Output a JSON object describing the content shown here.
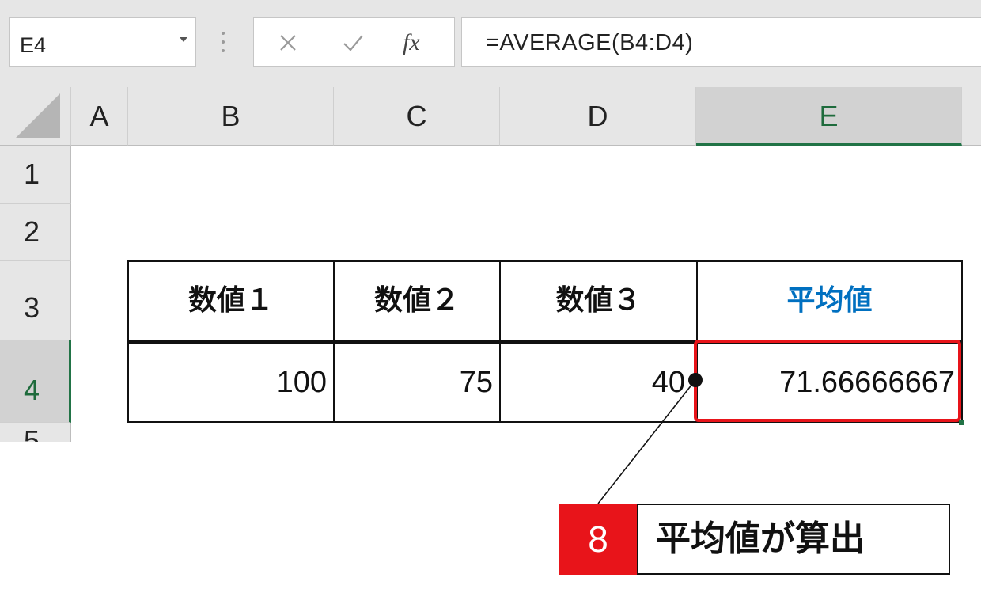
{
  "formula_bar": {
    "name_box": "E4",
    "formula": "=AVERAGE(B4:D4)",
    "fx_label": "fx"
  },
  "columns": [
    "A",
    "B",
    "C",
    "D",
    "E"
  ],
  "rows": [
    "1",
    "2",
    "3",
    "4",
    "5"
  ],
  "table": {
    "headers": [
      "数値１",
      "数値２",
      "数値３",
      "平均値"
    ],
    "values": [
      "100",
      "75",
      "40",
      "71.66666667"
    ]
  },
  "colors": {
    "average_header": "#0070c0",
    "highlight": "#e8141a",
    "selection": "#217346"
  },
  "callout": {
    "step_number": "8",
    "text": "平均値が算出"
  }
}
